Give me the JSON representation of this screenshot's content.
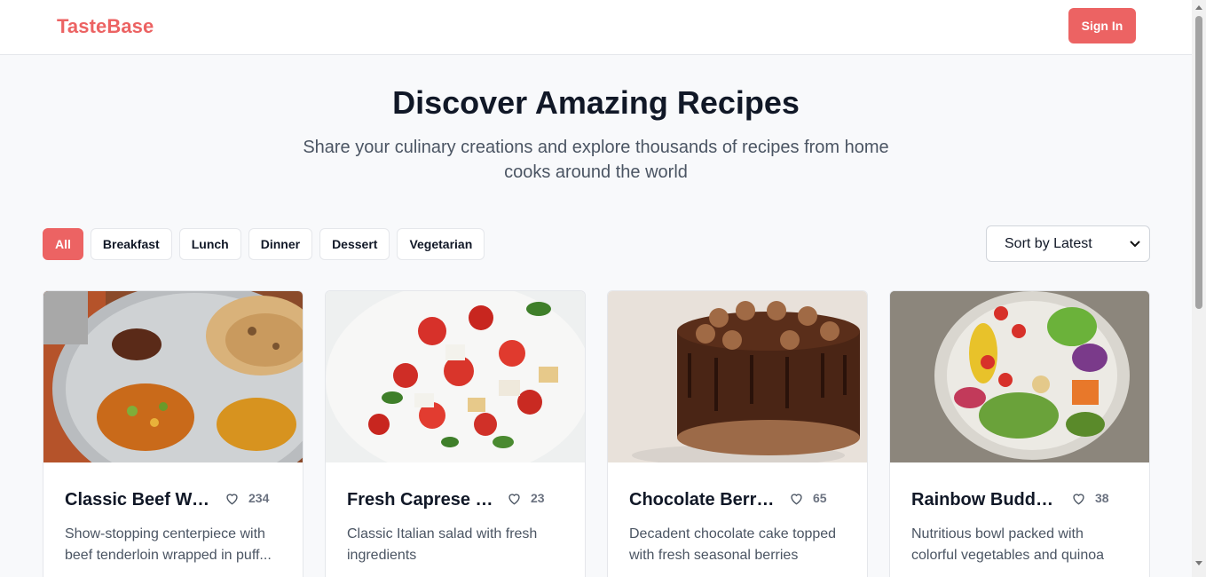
{
  "header": {
    "logo": "TasteBase",
    "signin_label": "Sign In"
  },
  "hero": {
    "title": "Discover Amazing Recipes",
    "subtitle": "Share your culinary creations and explore thousands of recipes from home cooks around the world"
  },
  "filters": [
    {
      "label": "All",
      "active": true
    },
    {
      "label": "Breakfast",
      "active": false
    },
    {
      "label": "Lunch",
      "active": false
    },
    {
      "label": "Dinner",
      "active": false
    },
    {
      "label": "Dessert",
      "active": false
    },
    {
      "label": "Vegetarian",
      "active": false
    }
  ],
  "sort": {
    "selected": "Sort by Latest"
  },
  "recipes": [
    {
      "title": "Classic Beef Well...",
      "likes": "234",
      "description": "Show-stopping centerpiece with beef tenderloin wrapped in puff..."
    },
    {
      "title": "Fresh Caprese Sal...",
      "likes": "23",
      "description": "Classic Italian salad with fresh ingredients"
    },
    {
      "title": "Chocolate Berry ...",
      "likes": "65",
      "description": "Decadent chocolate cake topped with fresh seasonal berries"
    },
    {
      "title": "Rainbow Buddha ...",
      "likes": "38",
      "description": "Nutritious bowl packed with colorful vegetables and quinoa"
    }
  ],
  "colors": {
    "accent": "#ec6363",
    "heading": "#111827",
    "muted": "#4b5563"
  }
}
